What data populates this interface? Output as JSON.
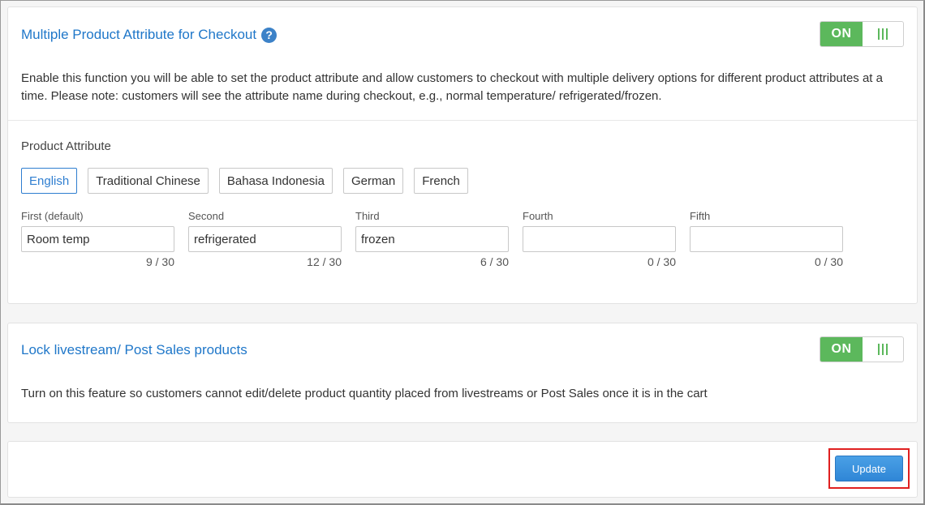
{
  "attribute_card": {
    "title": "Multiple Product Attribute for Checkout",
    "help_icon": "question-circle-icon",
    "toggle": {
      "state": "ON"
    },
    "description": "Enable this function you will be able to set the product attribute and allow customers to checkout with multiple delivery options for different product attributes at a time. Please note: customers will see the attribute name during checkout, e.g., normal temperature/ refrigerated/frozen.",
    "section_label": "Product Attribute",
    "languages": [
      {
        "label": "English",
        "active": true
      },
      {
        "label": "Traditional Chinese",
        "active": false
      },
      {
        "label": "Bahasa Indonesia",
        "active": false
      },
      {
        "label": "German",
        "active": false
      },
      {
        "label": "French",
        "active": false
      }
    ],
    "fields": [
      {
        "label": "First (default)",
        "value": "Room temp",
        "count": "9 / 30"
      },
      {
        "label": "Second",
        "value": "refrigerated",
        "count": "12 / 30"
      },
      {
        "label": "Third",
        "value": "frozen",
        "count": "6 / 30"
      },
      {
        "label": "Fourth",
        "value": "",
        "count": "0 / 30"
      },
      {
        "label": "Fifth",
        "value": "",
        "count": "0 / 30"
      }
    ]
  },
  "lock_card": {
    "title": "Lock livestream/ Post Sales products",
    "toggle": {
      "state": "ON"
    },
    "description": "Turn on this feature so customers cannot edit/delete product quantity placed from livestreams or Post Sales once it is in the cart"
  },
  "footer": {
    "update_label": "Update"
  },
  "colors": {
    "accent_blue": "#1f77c9",
    "toggle_green": "#5cb85c",
    "highlight_red": "#e02020"
  }
}
